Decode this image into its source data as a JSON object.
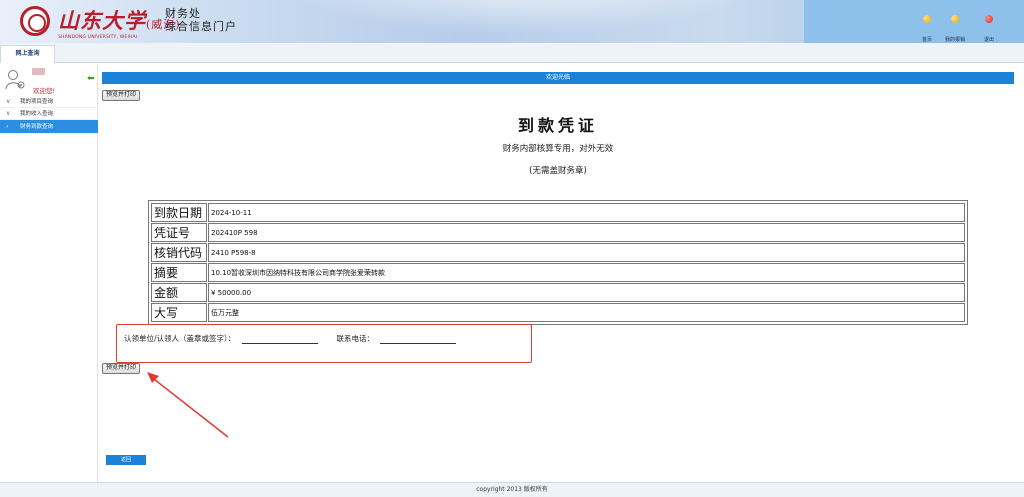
{
  "header": {
    "logo_text_zh": "山东大学",
    "logo_campus": "(威海)",
    "logo_text_en": "SHANDONG UNIVERSITY, WEIHAI",
    "title_line1": "财务处",
    "title_line2": "综合信息门户",
    "nav": [
      {
        "label": "首页",
        "color": "#e8a21a"
      },
      {
        "label": "我的报销",
        "color": "#e8a21a"
      },
      {
        "label": "退出",
        "color": "#d62a2a"
      }
    ]
  },
  "tabs": {
    "active": "网上查询"
  },
  "sidebar": {
    "welcome": "欢迎您!",
    "items": [
      {
        "label": "我的项目查询"
      },
      {
        "label": "我的收入查询"
      },
      {
        "label": "财务到款查询"
      }
    ]
  },
  "main": {
    "welcome_bar": "欢迎光临",
    "print_button": "预览并打印",
    "doc_title": "到款凭证",
    "doc_subtitle": "财务内部核算专用，对外无效",
    "doc_note": "(无需盖财务章)",
    "rows": [
      {
        "label": "到款日期",
        "value": "2024-10-11"
      },
      {
        "label": "凭证号",
        "value": "202410P 598"
      },
      {
        "label": "核销代码",
        "value": "2410 P598-8"
      },
      {
        "label": "摘要",
        "value": "10.10暂收深圳市因纳特科技有限公司商学院张爱荣转款"
      },
      {
        "label": "金额",
        "value": "¥ 50000.00"
      },
      {
        "label": "大写",
        "value": "伍万元整"
      }
    ],
    "sign_label": "认领单位/认领人（盖章或签字）：",
    "phone_label": "联系电话：",
    "back_button": "返回"
  },
  "footer": {
    "copyright": "copyright 2013 版权所有"
  },
  "colors": {
    "accent": "#1a83d8",
    "highlight": "#e03b32",
    "brand": "#b6202a"
  }
}
